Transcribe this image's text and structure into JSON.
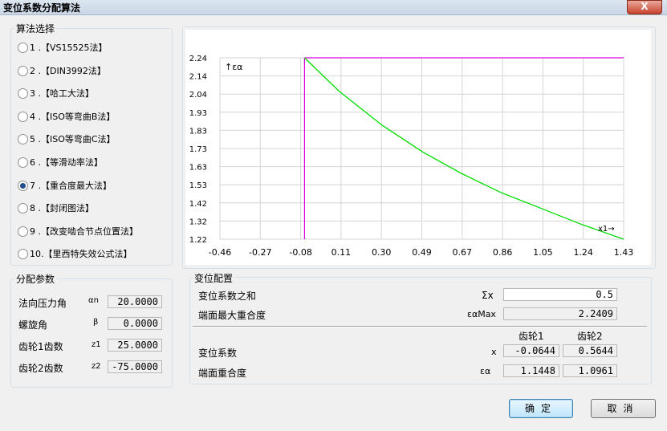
{
  "window": {
    "title": "变位系数分配算法",
    "close_label": "X"
  },
  "method_group": {
    "title": "算法选择",
    "selected_index": 6,
    "items": [
      {
        "label": "1 .【VS15525法】"
      },
      {
        "label": "2 .【DIN3992法】"
      },
      {
        "label": "3 .【哈工大法】"
      },
      {
        "label": "4 .【ISO等弯曲B法】"
      },
      {
        "label": "5 .【ISO等弯曲C法】"
      },
      {
        "label": "6 .【等滑动率法】"
      },
      {
        "label": "7 .【重合度最大法】"
      },
      {
        "label": "8 .【封闭图法】"
      },
      {
        "label": "9 .【改变啮合节点位置法】"
      },
      {
        "label": "10.【里西特失效公式法】"
      }
    ]
  },
  "params_group": {
    "title": "分配参数",
    "rows": [
      {
        "label": "法向压力角",
        "symbol": "αn",
        "value": "20.0000"
      },
      {
        "label": "螺旋角",
        "symbol": "β",
        "value": "0.0000"
      },
      {
        "label": "齿轮1齿数",
        "symbol": "z1",
        "value": "25.0000"
      },
      {
        "label": "齿轮2齿数",
        "symbol": "z2",
        "value": "-75.0000"
      }
    ]
  },
  "config_group": {
    "title": "变位配置",
    "sum_label": "变位系数之和",
    "sum_symbol": "Σx",
    "sum_value": "0.5",
    "max_label": "端面最大重合度",
    "max_symbol": "εαMax",
    "max_value": "2.2409",
    "col1": "齿轮1",
    "col2": "齿轮2",
    "coef_label": "变位系数",
    "coef_symbol": "x",
    "coef_values": [
      "-0.0644",
      "0.5644"
    ],
    "ratio_label": "端面重合度",
    "ratio_symbol": "εα",
    "ratio_values": [
      "1.1448",
      "1.0961"
    ]
  },
  "buttons": {
    "ok": "确定",
    "cancel": "取消"
  },
  "chart_data": {
    "type": "line",
    "ylabel": "↑εα",
    "xlabel": "x1→",
    "x_ticks": [
      "-0.46",
      "-0.27",
      "-0.08",
      "0.11",
      "0.30",
      "0.49",
      "0.67",
      "0.86",
      "1.05",
      "1.24",
      "1.43"
    ],
    "y_ticks": [
      "2.24",
      "2.14",
      "2.04",
      "1.93",
      "1.83",
      "1.73",
      "1.63",
      "1.53",
      "1.42",
      "1.32",
      "1.22"
    ],
    "xlim": [
      -0.46,
      1.43
    ],
    "ylim": [
      1.22,
      2.24
    ],
    "grid": true,
    "series": [
      {
        "color": "#00dd00",
        "x": [
          -0.064,
          0.1,
          0.3,
          0.49,
          0.67,
          0.86,
          1.05,
          1.24,
          1.43
        ],
        "y": [
          2.24,
          2.05,
          1.86,
          1.71,
          1.59,
          1.48,
          1.39,
          1.3,
          1.22
        ]
      }
    ],
    "reference_lines": {
      "color": "#dd00dd",
      "vertical_x": -0.064,
      "horizontal_y": 2.24
    }
  }
}
